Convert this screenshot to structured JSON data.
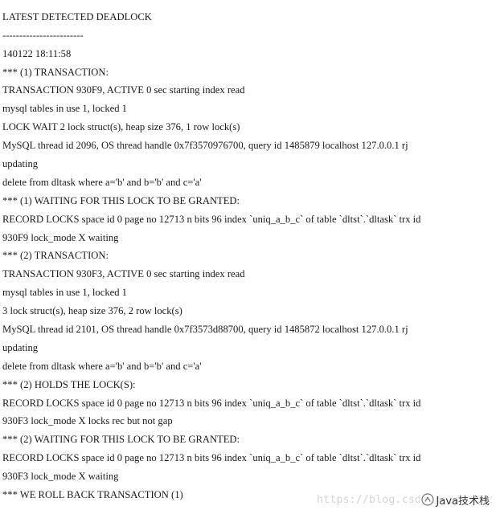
{
  "document": {
    "lines": [
      "------------------------",
      "LATEST DETECTED DEADLOCK",
      "------------------------",
      "140122 18:11:58",
      "*** (1) TRANSACTION:",
      "TRANSACTION 930F9, ACTIVE 0 sec starting index read",
      "mysql tables in use 1, locked 1",
      "LOCK WAIT 2 lock struct(s), heap size 376, 1 row lock(s)",
      "MySQL thread id 2096, OS thread handle 0x7f3570976700, query id 1485879 localhost 127.0.0.1 rj",
      "updating",
      "delete from dltask where a='b' and b='b' and c='a'",
      "*** (1) WAITING FOR THIS LOCK TO BE GRANTED:",
      "RECORD LOCKS space id 0 page no 12713 n bits 96 index `uniq_a_b_c` of table `dltst`.`dltask` trx id",
      "930F9 lock_mode X waiting",
      "*** (2) TRANSACTION:",
      "TRANSACTION 930F3, ACTIVE 0 sec starting index read",
      "mysql tables in use 1, locked 1",
      "3 lock struct(s), heap size 376, 2 row lock(s)",
      "MySQL thread id 2101, OS thread handle 0x7f3573d88700, query id 1485872 localhost 127.0.0.1 rj",
      "updating",
      "delete from dltask where a='b' and b='b' and c='a'",
      "*** (2) HOLDS THE LOCK(S):",
      "RECORD LOCKS space id 0 page no 12713 n bits 96 index `uniq_a_b_c` of table `dltst`.`dltask` trx id",
      "930F3 lock_mode X locks rec but not gap",
      "*** (2) WAITING FOR THIS LOCK TO BE GRANTED:",
      "RECORD LOCKS space id 0 page no 12713 n bits 96 index `uniq_a_b_c` of table `dltst`.`dltask` trx id",
      "930F3 lock_mode X waiting",
      "*** WE ROLL BACK TRANSACTION (1)"
    ]
  },
  "watermark": {
    "url": "https://blog.csdn.net/trihz",
    "brand": "Java技术栈",
    "brand_icon": "wechat-official-account-icon"
  }
}
